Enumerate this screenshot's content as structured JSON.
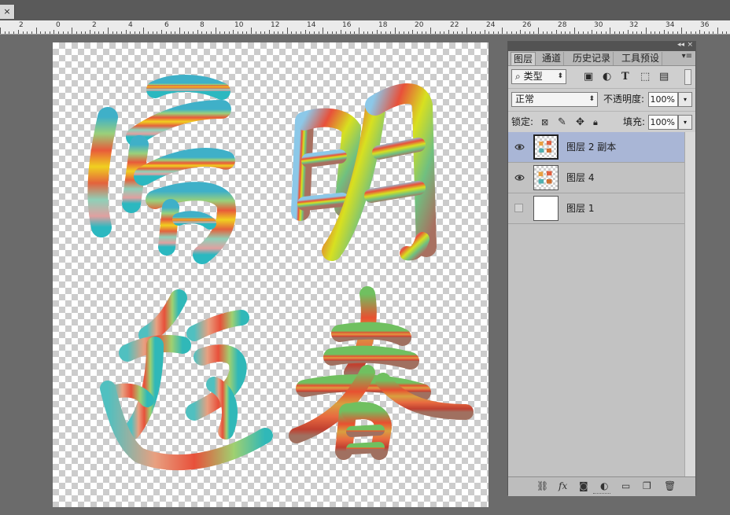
{
  "document": {
    "close_glyph": "×"
  },
  "ruler": {
    "labels": [
      "2",
      "0",
      "2",
      "4",
      "6",
      "8",
      "10",
      "12",
      "14",
      "16",
      "18",
      "20",
      "22",
      "24",
      "26",
      "28",
      "30",
      "32",
      "34",
      "36"
    ]
  },
  "canvas": {
    "artwork_description_icon": "calligraphy-artwork",
    "characters": [
      "清",
      "明",
      "游",
      "春"
    ]
  },
  "panel": {
    "tabs": [
      {
        "label": "图层",
        "active": true
      },
      {
        "label": "通道",
        "active": false
      },
      {
        "label": "历史记录",
        "active": false
      },
      {
        "label": "工具预设",
        "active": false
      }
    ],
    "menu_glyph": "▾≡",
    "filter": {
      "search_glyph": "⌕",
      "value": "类型"
    },
    "blend": {
      "value": "正常",
      "opacity_label": "不透明度:",
      "opacity": "100%"
    },
    "lock": {
      "label": "锁定:",
      "fill_label": "填充:",
      "fill": "100%"
    },
    "layers": [
      {
        "name": "图层 2 副本",
        "visible": true,
        "selected": true,
        "thumb": "art"
      },
      {
        "name": "图层 4",
        "visible": true,
        "selected": false,
        "thumb": "art"
      },
      {
        "name": "图层 1",
        "visible": false,
        "selected": false,
        "thumb": "white"
      }
    ],
    "bottom_icons": [
      "link-icon",
      "fx-icon",
      "mask-icon",
      "adjustment-icon",
      "folder-icon",
      "new-layer-icon",
      "trash-icon"
    ],
    "fx_label": "fx"
  },
  "colors": {
    "selected_layer": "#a9b6d6",
    "panel_bg": "#cfcfcf",
    "workspace": "#6b6b6b"
  }
}
